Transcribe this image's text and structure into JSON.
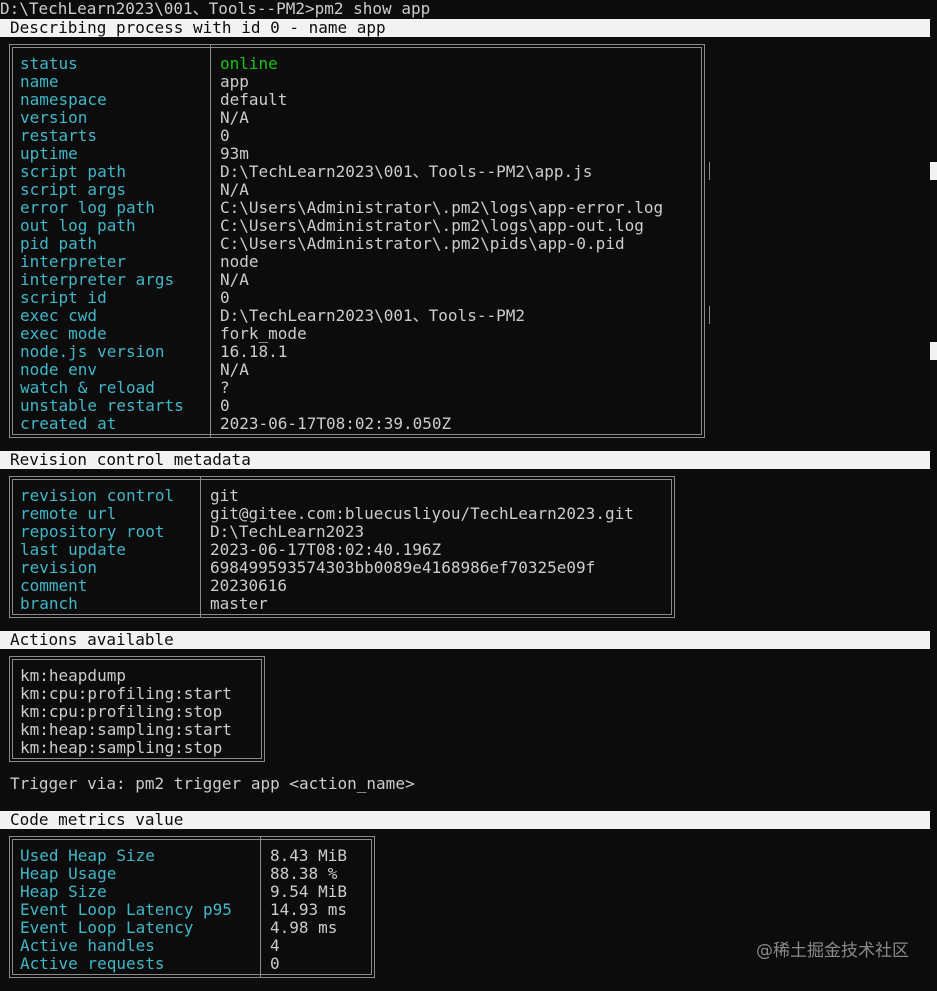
{
  "prompt": {
    "command_line": "D:\\TechLearn2023\\001、Tools--PM2>pm2 show app"
  },
  "sections": {
    "process": {
      "title": "Describing process with id 0 - name app",
      "rows": [
        {
          "key": "status",
          "value": "online",
          "value_color": "#16c60c"
        },
        {
          "key": "name",
          "value": "app"
        },
        {
          "key": "namespace",
          "value": "default"
        },
        {
          "key": "version",
          "value": "N/A"
        },
        {
          "key": "restarts",
          "value": "0"
        },
        {
          "key": "uptime",
          "value": "93m"
        },
        {
          "key": "script path",
          "value": "D:\\TechLearn2023\\001、Tools--PM2\\app.js"
        },
        {
          "key": "script args",
          "value": "N/A"
        },
        {
          "key": "error log path",
          "value": "C:\\Users\\Administrator\\.pm2\\logs\\app-error.log"
        },
        {
          "key": "out log path",
          "value": "C:\\Users\\Administrator\\.pm2\\logs\\app-out.log"
        },
        {
          "key": "pid path",
          "value": "C:\\Users\\Administrator\\.pm2\\pids\\app-0.pid"
        },
        {
          "key": "interpreter",
          "value": "node"
        },
        {
          "key": "interpreter args",
          "value": "N/A"
        },
        {
          "key": "script id",
          "value": "0"
        },
        {
          "key": "exec cwd",
          "value": "D:\\TechLearn2023\\001、Tools--PM2"
        },
        {
          "key": "exec mode",
          "value": "fork_mode"
        },
        {
          "key": "node.js version",
          "value": "16.18.1"
        },
        {
          "key": "node env",
          "value": "N/A"
        },
        {
          "key": "watch & reload",
          "value": "?"
        },
        {
          "key": "unstable restarts",
          "value": "0"
        },
        {
          "key": "created at",
          "value": "2023-06-17T08:02:39.050Z"
        }
      ]
    },
    "revision": {
      "title": "Revision control metadata",
      "rows": [
        {
          "key": "revision control",
          "value": "git"
        },
        {
          "key": "remote url",
          "value": "git@gitee.com:bluecusliyou/TechLearn2023.git"
        },
        {
          "key": "repository root",
          "value": "D:\\TechLearn2023"
        },
        {
          "key": "last update",
          "value": "2023-06-17T08:02:40.196Z"
        },
        {
          "key": "revision",
          "value": "698499593574303bb0089e4168986ef70325e09f"
        },
        {
          "key": "comment",
          "value": "20230616"
        },
        {
          "key": "branch",
          "value": "master"
        }
      ]
    },
    "actions": {
      "title": "Actions available",
      "items": [
        "km:heapdump",
        "km:cpu:profiling:start",
        "km:cpu:profiling:stop",
        "km:heap:sampling:start",
        "km:heap:sampling:stop"
      ],
      "trigger_hint": "Trigger via: pm2 trigger app <action_name>"
    },
    "metrics": {
      "title": "Code metrics value",
      "rows": [
        {
          "key": "Used Heap Size",
          "value": "8.43 MiB"
        },
        {
          "key": "Heap Usage",
          "value": "88.38 %"
        },
        {
          "key": "Heap Size",
          "value": "9.54 MiB"
        },
        {
          "key": "Event Loop Latency p95",
          "value": "14.93 ms"
        },
        {
          "key": "Event Loop Latency",
          "value": "4.98 ms"
        },
        {
          "key": "Active handles",
          "value": "4"
        },
        {
          "key": "Active requests",
          "value": "0"
        }
      ]
    }
  },
  "watermark": "@稀土掘金技术社区",
  "colors": {
    "background": "#0c0c0c",
    "text": "#cccccc",
    "key_cyan": "#3fb7c9",
    "status_green": "#16c60c",
    "header_bar": "#f2f2f2",
    "border": "#8a8a8a"
  }
}
